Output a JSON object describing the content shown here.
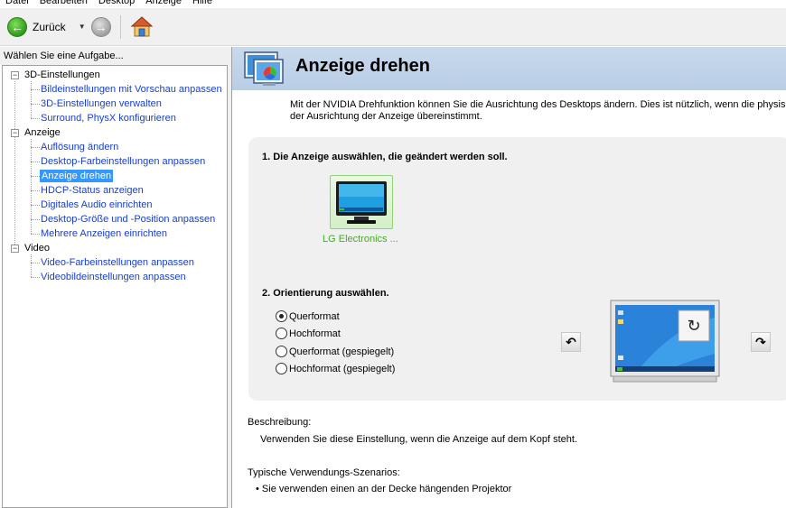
{
  "menu": [
    "Datei",
    "Bearbeiten",
    "Desktop",
    "Anzeige",
    "Hilfe"
  ],
  "toolbar": {
    "back_label": "Zurück"
  },
  "tasks": {
    "header": "Wählen Sie eine Aufgabe...",
    "categories": [
      {
        "label": "3D-Einstellungen",
        "items": [
          "Bildeinstellungen mit Vorschau anpassen",
          "3D-Einstellungen verwalten",
          "Surround, PhysX konfigurieren"
        ]
      },
      {
        "label": "Anzeige",
        "items": [
          "Auflösung ändern",
          "Desktop-Farbeinstellungen anpassen",
          "Anzeige drehen",
          "HDCP-Status anzeigen",
          "Digitales Audio einrichten",
          "Desktop-Größe und -Position anpassen",
          "Mehrere Anzeigen einrichten"
        ]
      },
      {
        "label": "Video",
        "items": [
          "Video-Farbeinstellungen anpassen",
          "Videobildeinstellungen anpassen"
        ]
      }
    ],
    "selected": "Anzeige drehen"
  },
  "page": {
    "title": "Anzeige drehen",
    "intro_line1": "Mit der NVIDIA Drehfunktion können Sie die Ausrichtung des Desktops ändern. Dies ist nützlich, wenn die physische",
    "intro_line2": "der Ausrichtung der Anzeige übereinstimmt.",
    "step1": "1. Die Anzeige auswählen, die geändert werden soll.",
    "display_name": "LG Electronics ...",
    "step2": "2.  Orientierung auswählen.",
    "orientations": [
      {
        "label": "Querformat",
        "checked": true
      },
      {
        "label": "Hochformat",
        "checked": false
      },
      {
        "label": "Querformat (gespiegelt)",
        "checked": false
      },
      {
        "label": "Hochformat (gespiegelt)",
        "checked": false
      }
    ],
    "description_label": "Beschreibung:",
    "description_text": "Verwenden Sie diese Einstellung, wenn die Anzeige auf dem Kopf steht.",
    "usage_label": "Typische Verwendungs-Szenarios:",
    "usage_text": "• Sie verwenden einen an der Decke hängenden Projektor"
  },
  "colors": {
    "banner": "#c2d4ea",
    "link": "#1a3ec8",
    "selected_bg": "#3399ff",
    "display_label": "#49a82b",
    "panel_bg": "#f0f0f0"
  }
}
